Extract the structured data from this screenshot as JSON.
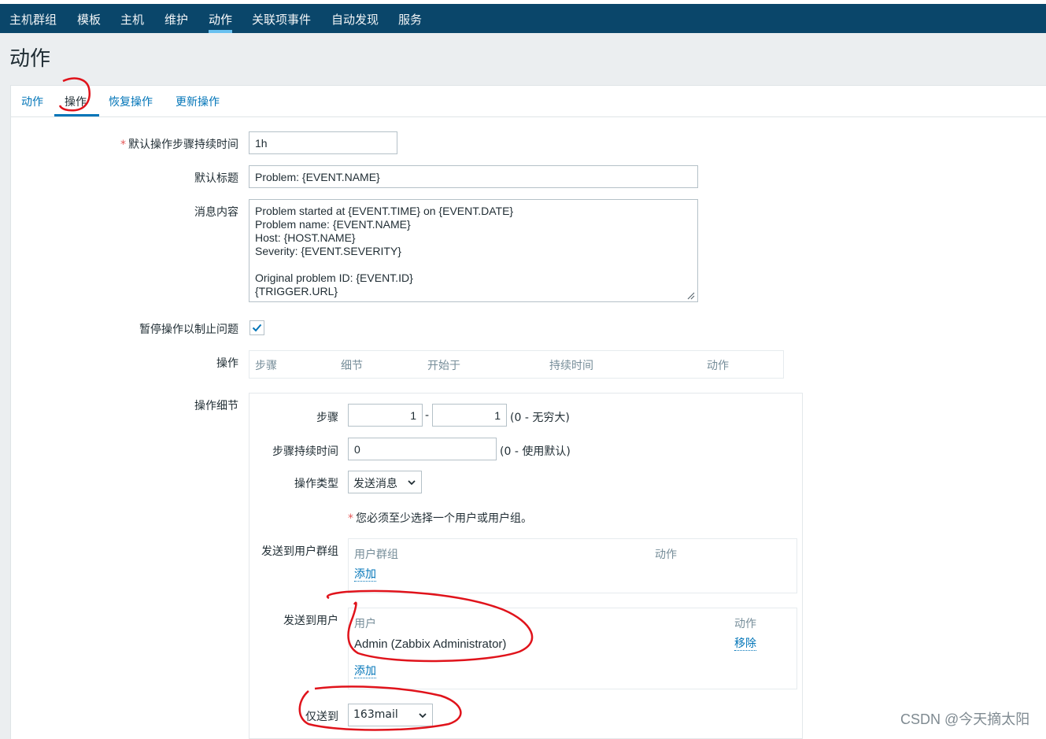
{
  "topnav": {
    "items": [
      "主机群组",
      "模板",
      "主机",
      "维护",
      "动作",
      "关联项事件",
      "自动发现",
      "服务"
    ],
    "active": "动作"
  },
  "page": {
    "title": "动作"
  },
  "tabs": {
    "items": [
      "动作",
      "操作",
      "恢复操作",
      "更新操作"
    ],
    "active": "操作"
  },
  "form": {
    "default_step_duration": {
      "label": "默认操作步骤持续时间",
      "required_mark": "*",
      "value": "1h"
    },
    "default_subject": {
      "label": "默认标题",
      "value": "Problem: {EVENT.NAME}"
    },
    "message": {
      "label": "消息内容",
      "value": "Problem started at {EVENT.TIME} on {EVENT.DATE}\nProblem name: {EVENT.NAME}\nHost: {HOST.NAME}\nSeverity: {EVENT.SEVERITY}\n\nOriginal problem ID: {EVENT.ID}\n{TRIGGER.URL}"
    },
    "pause": {
      "label": "暂停操作以制止问题",
      "checked": true
    },
    "operations": {
      "label": "操作",
      "columns": [
        "步骤",
        "细节",
        "开始于",
        "持续时间",
        "动作"
      ]
    },
    "operation_details": {
      "label": "操作细节",
      "steps": {
        "label": "步骤",
        "from": "1",
        "separator": "-",
        "to": "1",
        "hint": "(0 - 无穷大)"
      },
      "step_duration": {
        "label": "步骤持续时间",
        "value": "0",
        "hint": "(0 - 使用默认)"
      },
      "operation_type": {
        "label": "操作类型",
        "value": "发送消息"
      },
      "notice": {
        "mark": "*",
        "text": "您必须至少选择一个用户或用户组。"
      },
      "send_to_groups": {
        "label": "发送到用户群组",
        "columns": [
          "用户群组",
          "动作"
        ],
        "add": "添加"
      },
      "send_to_users": {
        "label": "发送到用户",
        "columns": [
          "用户",
          "动作"
        ],
        "rows": [
          {
            "user": "Admin (Zabbix Administrator)",
            "action": "移除"
          }
        ],
        "add": "添加"
      },
      "send_only_to": {
        "label": "仅送到",
        "value": "163mail"
      }
    }
  },
  "watermark": "CSDN @今天摘太阳",
  "colors": {
    "nav_bg": "#0a466a",
    "link": "#0275b8",
    "annotation": "#e0131b",
    "required": "#e45959"
  }
}
